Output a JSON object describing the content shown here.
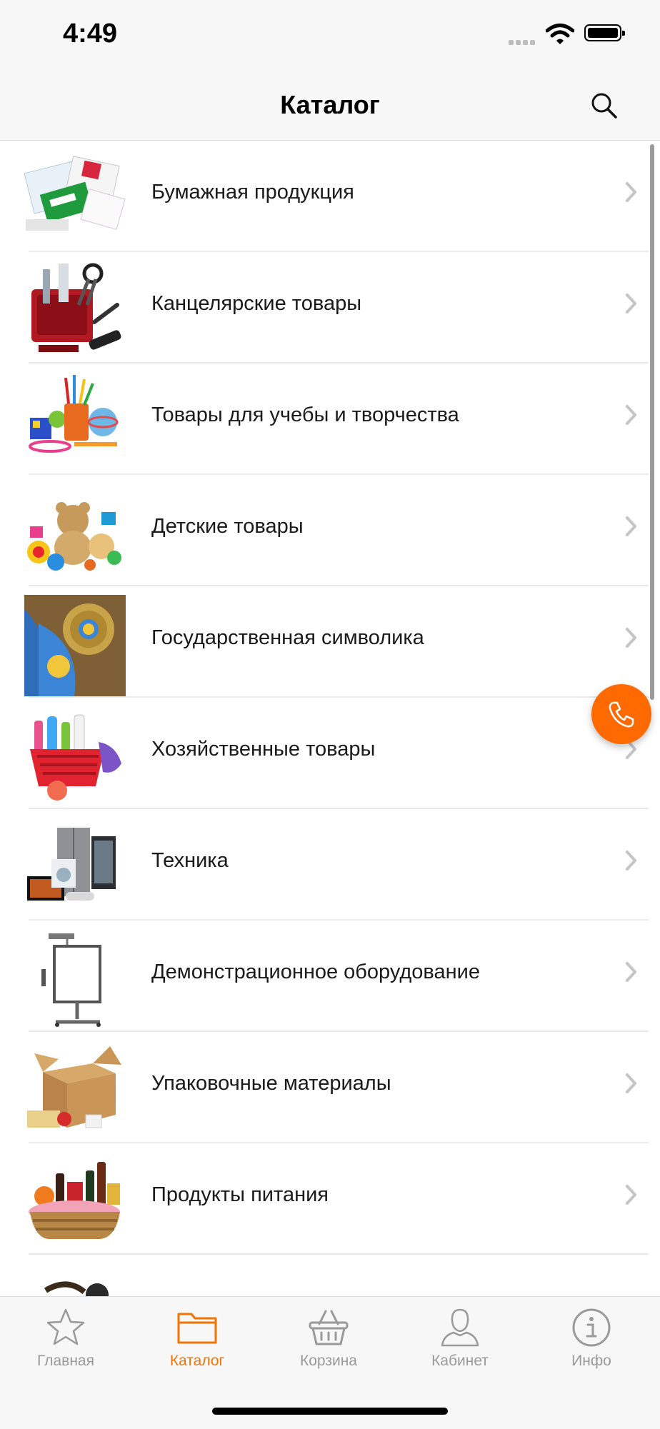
{
  "status_bar": {
    "time": "4:49"
  },
  "header": {
    "title": "Каталог",
    "search_icon": "search-icon"
  },
  "catalog": {
    "items": [
      {
        "label": "Бумажная продукция",
        "thumb": "paper-products-image"
      },
      {
        "label": "Канцелярские товары",
        "thumb": "stationery-image"
      },
      {
        "label": "Товары для учебы и творчества",
        "thumb": "school-art-supplies-image"
      },
      {
        "label": "Детские товары",
        "thumb": "kids-toys-image"
      },
      {
        "label": "Государственная символика",
        "thumb": "state-symbols-image"
      },
      {
        "label": "Хозяйственные товары",
        "thumb": "household-goods-image"
      },
      {
        "label": "Техника",
        "thumb": "appliances-image"
      },
      {
        "label": "Демонстрационное оборудование",
        "thumb": "presentation-equipment-image"
      },
      {
        "label": "Упаковочные материалы",
        "thumb": "packaging-materials-image"
      },
      {
        "label": "Продукты питания",
        "thumb": "food-basket-image"
      },
      {
        "label": "",
        "thumb": "partially-visible-item-image"
      }
    ]
  },
  "tab_bar": {
    "tabs": [
      {
        "label": "Главная",
        "icon": "star-icon",
        "active": false
      },
      {
        "label": "Каталог",
        "icon": "folder-icon",
        "active": true
      },
      {
        "label": "Корзина",
        "icon": "basket-icon",
        "active": false
      },
      {
        "label": "Кабинет",
        "icon": "user-icon",
        "active": false
      },
      {
        "label": "Инфо",
        "icon": "info-icon",
        "active": false
      }
    ]
  },
  "colors": {
    "accent": "#f27405",
    "call_button": "#ff6a00",
    "tab_inactive": "#9a9a9a",
    "bar_background": "#f7f7f7"
  }
}
